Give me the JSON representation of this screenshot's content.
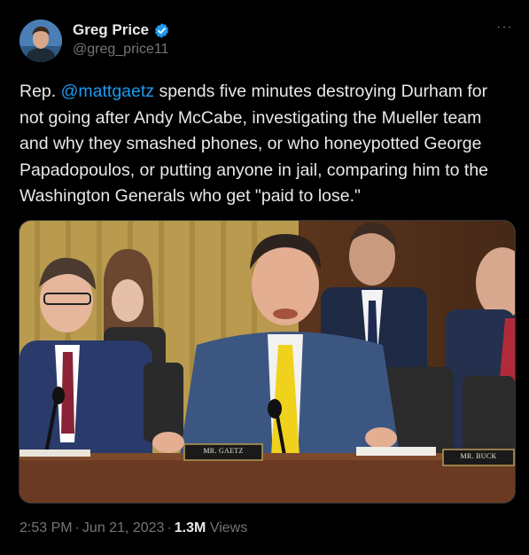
{
  "author": {
    "display_name": "Greg Price",
    "handle": "@greg_price11",
    "verified": true,
    "avatar_icon": "profile-photo"
  },
  "more_icon": "more-horizontal-icon",
  "more_glyph": "···",
  "tweet": {
    "prefix": "Rep. ",
    "mention": "@mattgaetz",
    "body": " spends five minutes destroying Durham for not going after Andy McCabe, investigating the Mueller team and why they smashed phones, or who honeypotted George Papadopoulos, or putting anyone in jail, comparing him to the Washington Generals who get \"paid to lose.\""
  },
  "media": {
    "nameplate_center": "MR. GAETZ",
    "nameplate_right": "MR. BUCK"
  },
  "footer": {
    "time": "2:53 PM",
    "dot1": "·",
    "date": "Jun 21, 2023",
    "dot2": "·",
    "views_count": "1.3M",
    "views_label": "Views"
  },
  "colors": {
    "background": "#000000",
    "text_primary": "#e7e9ea",
    "text_secondary": "#71767b",
    "link": "#1d9bf0",
    "verified_badge": "#1d9bf0"
  }
}
